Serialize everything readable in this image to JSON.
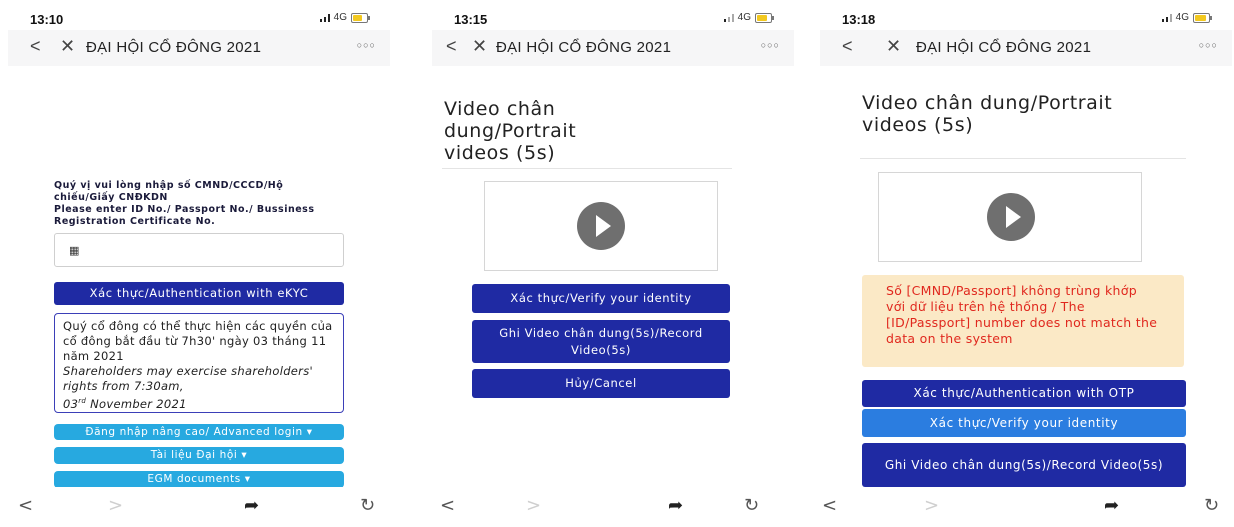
{
  "nav": {
    "title": "ĐẠI HỘI CỔ ĐÔNG 2021",
    "back": "<",
    "close": "✕",
    "more": "○○○"
  },
  "network": "4G",
  "screen1": {
    "time": "13:10",
    "prompt_vi": "Quý vị vui lòng nhập số CMND/CCCD/Hộ chiếu/Giấy CNĐKDN",
    "prompt_en": "Please enter ID No./ Passport No./ Bussiness Registration Certificate No.",
    "id_input_value": "",
    "keypad_icon": "keypad-icon",
    "auth_ekyc_label": "Xác thực/Authentication with eKYC",
    "notice": {
      "vi": "Quý cổ đông có thể thực hiện các quyền của cổ đông bắt đầu từ 7h30' ngày 03 tháng 11 năm 2021",
      "en": "Shareholders may exercise shareholders' rights from 7:30am,",
      "date_day": "03",
      "date_sup": "rd",
      "date_rest": " November 2021"
    },
    "advanced_login_label": "Đăng nhập nâng cao/ Advanced login ▾",
    "documents_label": "Tài liệu Đại hội ▾",
    "egm_label": "EGM documents ▾"
  },
  "screen2": {
    "time": "13:15",
    "video_title": "Video chân dung/Portrait videos (5s)",
    "verify_label": "Xác thực/Verify your identity",
    "record_label": "Ghi Video chân dung(5s)/Record Video(5s)",
    "cancel_label": "Hủy/Cancel"
  },
  "screen3": {
    "time": "13:18",
    "video_title": "Video chân dung/Portrait videos (5s)",
    "error_text": "Số [CMND/Passport] không trùng khớp với dữ liệu trên hệ thống / The [ID/Passport] number does not match the data on the system",
    "auth_otp_label": "Xác thực/Authentication with OTP",
    "verify_label": "Xác thực/Verify your identity",
    "record_label": "Ghi Video chân dung(5s)/Record Video(5s)"
  },
  "colors": {
    "primary": "#1f2aa3",
    "secondary": "#2b7de0",
    "light": "#27a9e0",
    "error_bg": "#fbe9c6",
    "error_text": "#e0281e"
  }
}
